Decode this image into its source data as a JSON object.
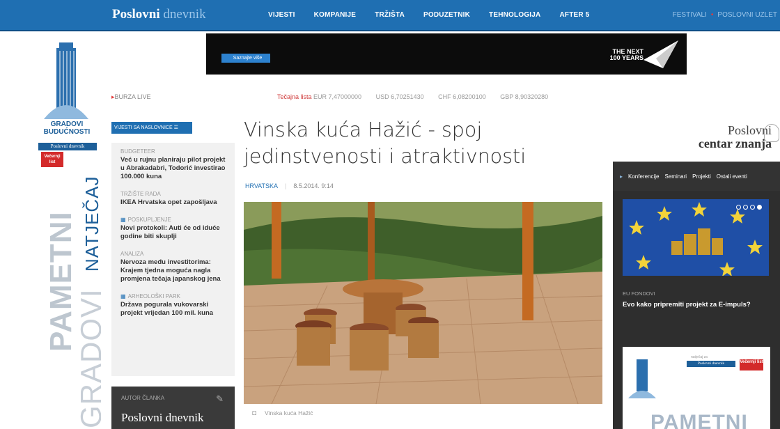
{
  "header": {
    "logo_bold": "Poslovni",
    "logo_light": "dnevnik",
    "nav": [
      "VIJESTI",
      "KOMPANIJE",
      "TRŽIŠTA",
      "PODUZETNIK",
      "TEHNOLOGIJA",
      "AFTER 5"
    ],
    "right_links": [
      "FESTIVALI",
      "POSLOVNI UZLET"
    ]
  },
  "left_banner": {
    "line1": "GRADOVI",
    "line2": "BUDUĆNOSTI",
    "pd_logo": "Poslovni dnevnik",
    "vl_logo": "Večernji list",
    "pametni": "PAMETNI",
    "gradovi": "GRADOVI",
    "natjecaj": "NATJEČAJ"
  },
  "ad": {
    "button": "Saznajte više",
    "brand_line1": "THE NEXT",
    "brand_line2": "100 YEARS"
  },
  "ticker": {
    "burza": "BURZA LIVE",
    "label": "Tečajna lista",
    "rates": [
      "EUR  7,47000000",
      "USD  6,70251430",
      "CHF  6,08200100",
      "GBP  8,90320280"
    ]
  },
  "sidebar": {
    "news_button": "VIJESTI SA NASLOVNICE",
    "items": [
      {
        "cat": "BUDGETEER",
        "title": "Već u rujnu planiraju pilot projekt u Abrakadabri, Todorić investirao 100.000 kuna",
        "icon": false
      },
      {
        "cat": "TRŽIŠTE RADA",
        "title": "IKEA Hrvatska opet zapošljava",
        "icon": false
      },
      {
        "cat": "POSKUPLJENJE",
        "title": "Novi protokoli: Auti će od iduće godine biti skuplji",
        "icon": true
      },
      {
        "cat": "ANALIZA",
        "title": "Nervoza među investitorima: Krajem tjedna moguća nagla promjena tečaja japanskog jena",
        "icon": false
      },
      {
        "cat": "ARHEOLOŠKI PARK",
        "title": "Država pogurala vukovarski projekt vrijedan 100 mil. kuna",
        "icon": true
      }
    ],
    "author_label": "AUTOR ČLANKA",
    "author_name": "Poslovni dnevnik"
  },
  "article": {
    "title_line1": "Vinska kuća Hažić - spoj",
    "title_line2": "jedinstvenosti i atraktivnosti",
    "category": "HRVATSKA",
    "date": "8.5.2014.  9:14",
    "caption": "Vinska kuća Hažić"
  },
  "right": {
    "title1": "Poslovni",
    "title2": "centar znanja",
    "tabs": [
      "Konferencije",
      "Seminari",
      "Projekti",
      "Ostali eventi"
    ],
    "card_cat": "EU FONDOVI",
    "card_title": "Evo kako pripremiti projekt za E-impuls?",
    "ad_small": "natječaj za",
    "ad_pd": "Poslovni dnevnik",
    "ad_vl": "Večernji list",
    "ad_word": "PAMETNI"
  },
  "colors": {
    "brand_blue": "#1f6fb2",
    "accent_red": "#d32a2a",
    "dark_panel": "#2e2e2e"
  }
}
